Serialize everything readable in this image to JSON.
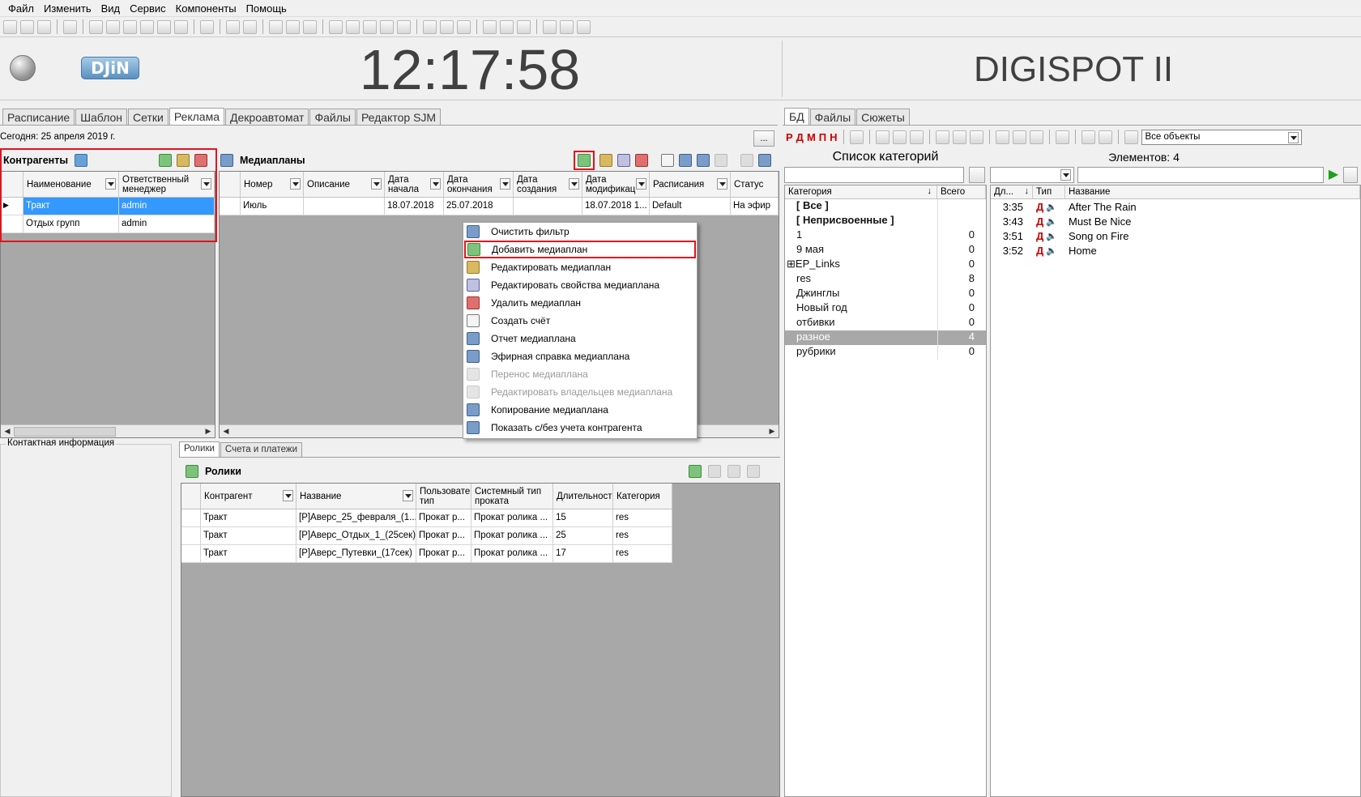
{
  "menu": [
    "Файл",
    "Изменить",
    "Вид",
    "Сервис",
    "Компоненты",
    "Помощь"
  ],
  "clock": "12:17:58",
  "brand": "DIGISPOT II",
  "logo": "DJiN",
  "main_tabs": [
    "Расписание",
    "Шаблон",
    "Сетки",
    "Реклама",
    "Декроавтомат",
    "Файлы",
    "Редактор SJM"
  ],
  "today": "Сегодня: 25 апреля 2019 г.",
  "ellipsis": "...",
  "contragents": {
    "title": "Контрагенты",
    "col1": "Наименование",
    "col2": "Ответственный менеджер",
    "rows": [
      [
        "Тракт",
        "admin"
      ],
      [
        "Отдых групп",
        "admin"
      ]
    ]
  },
  "mediaplans": {
    "title": "Медиапланы",
    "cols": [
      "Номер",
      "Описание",
      "Дата начала",
      "Дата окончания",
      "Дата создания",
      "Дата модификац",
      "Расписания",
      "Статус"
    ],
    "rows": [
      [
        "Июль",
        "",
        "18.07.2018",
        "25.07.2018",
        "",
        "18.07.2018 1...",
        "Default",
        "На эфир"
      ]
    ]
  },
  "context_menu": [
    {
      "label": "Очистить фильтр",
      "enabled": true,
      "icon": "clear-filter-icon"
    },
    {
      "label": "Добавить медиаплан",
      "enabled": true,
      "icon": "add-mediaplan-icon"
    },
    {
      "label": "Редактировать медиаплан",
      "enabled": true,
      "icon": "edit-mediaplan-icon"
    },
    {
      "label": "Редактировать свойства медиаплана",
      "enabled": true,
      "icon": "edit-properties-icon"
    },
    {
      "label": "Удалить медиаплан",
      "enabled": true,
      "icon": "delete-mediaplan-icon"
    },
    {
      "label": "Создать счёт",
      "enabled": true,
      "icon": "invoice-icon"
    },
    {
      "label": "Отчет медиаплана",
      "enabled": true,
      "icon": "report-icon"
    },
    {
      "label": "Эфирная справка медиаплана",
      "enabled": true,
      "icon": "broadcast-report-icon"
    },
    {
      "label": "Перенос медиаплана",
      "enabled": false,
      "icon": "transfer-icon"
    },
    {
      "label": "Редактировать владельцев медиаплана",
      "enabled": false,
      "icon": "owners-icon"
    },
    {
      "label": "Копирование медиаплана",
      "enabled": true,
      "icon": "copy-icon"
    },
    {
      "label": "Показать с/без учета контрагента",
      "enabled": true,
      "icon": "toggle-contragent-icon"
    }
  ],
  "contact_info": "Контактная информация",
  "bottom_tabs": [
    "Ролики",
    "Счета и платежи"
  ],
  "clips": {
    "title": "Ролики",
    "cols": [
      "Контрагент",
      "Название",
      "Пользовате тип",
      "Системный тип проката",
      "Длительност",
      "Категория"
    ],
    "rows": [
      [
        "Тракт",
        "[P]Аверс_25_февраля_(1...",
        "Прокат р...",
        "Прокат ролика ...",
        "15",
        "res"
      ],
      [
        "Тракт",
        "[P]Аверс_Отдых_1_(25сек)",
        "Прокат р...",
        "Прокат ролика ...",
        "25",
        "res"
      ],
      [
        "Тракт",
        "[P]Аверс_Путевки_(17сек)",
        "Прокат р...",
        "Прокат ролика ...",
        "17",
        "res"
      ]
    ]
  },
  "right_tabs": [
    "БД",
    "Файлы",
    "Сюжеты"
  ],
  "filter_select": "Все объекты",
  "categories": {
    "title": "Список категорий",
    "col1": "Категория",
    "col2": "Всего",
    "rows": [
      {
        "name": "[ Все ]",
        "count": "",
        "bold": true
      },
      {
        "name": "[ Неприсвоенные ]",
        "count": "",
        "bold": true
      },
      {
        "name": "1",
        "count": "0"
      },
      {
        "name": "9 мая",
        "count": "0"
      },
      {
        "name": "EP_Links",
        "count": "0",
        "expand": true
      },
      {
        "name": "res",
        "count": "8"
      },
      {
        "name": "Джинглы",
        "count": "0"
      },
      {
        "name": "Новый год",
        "count": "0"
      },
      {
        "name": "отбивки",
        "count": "0"
      },
      {
        "name": "разное",
        "count": "4",
        "selected": true
      },
      {
        "name": "рубрики",
        "count": "0"
      }
    ]
  },
  "elements": {
    "title": "Элементов: 4",
    "col1": "Дл...",
    "col2": "Тип",
    "col3": "Название",
    "rows": [
      {
        "dur": "3:35",
        "name": "After The Rain"
      },
      {
        "dur": "3:43",
        "name": "Must Be Nice"
      },
      {
        "dur": "3:51",
        "name": "Song on Fire"
      },
      {
        "dur": "3:52",
        "name": "Home"
      }
    ]
  },
  "type_letters": [
    "Р",
    "Д",
    "М",
    "П",
    "Н"
  ],
  "colors": {
    "accent": "#3399ff",
    "highlight": "#e0141e",
    "grid_bg": "#a8a8a8"
  }
}
